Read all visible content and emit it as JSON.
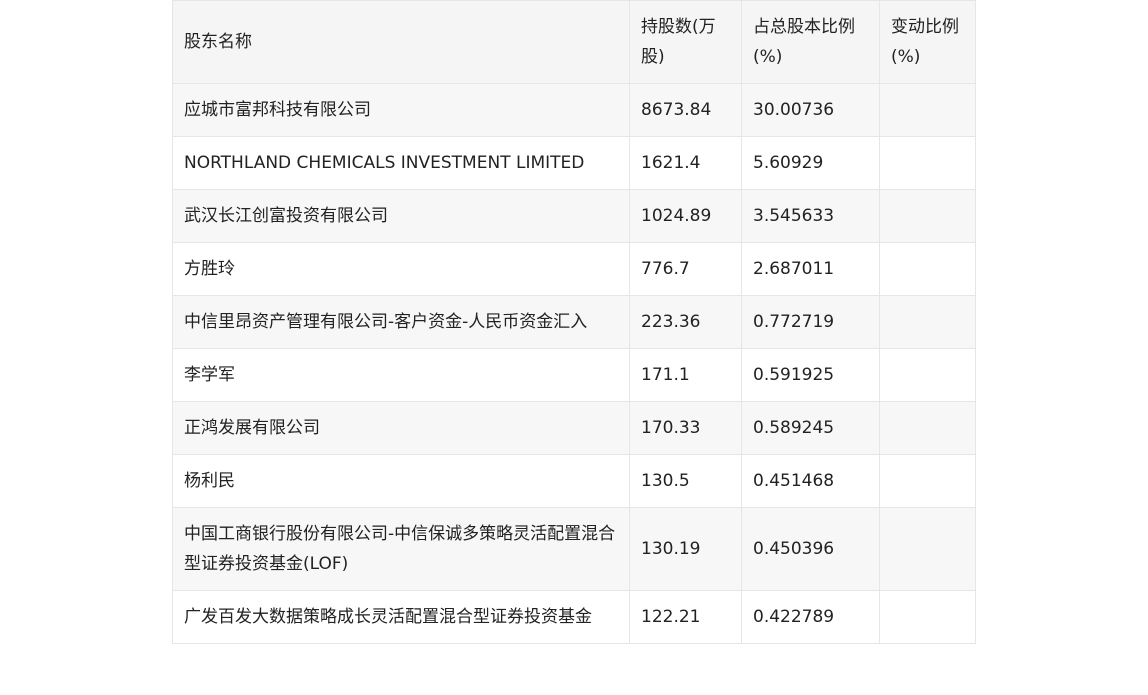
{
  "table": {
    "headers": {
      "name": "股东名称",
      "shares": "持股数(万股)",
      "ratio": "占总股本比例(%)",
      "change": "变动比例(%)"
    },
    "rows": [
      {
        "name": "应城市富邦科技有限公司",
        "shares": "8673.84",
        "ratio": "30.00736",
        "change": ""
      },
      {
        "name": "NORTHLAND CHEMICALS INVESTMENT LIMITED",
        "shares": "1621.4",
        "ratio": "5.60929",
        "change": ""
      },
      {
        "name": "武汉长江创富投资有限公司",
        "shares": "1024.89",
        "ratio": "3.545633",
        "change": ""
      },
      {
        "name": "方胜玲",
        "shares": "776.7",
        "ratio": "2.687011",
        "change": ""
      },
      {
        "name": "中信里昂资产管理有限公司-客户资金-人民币资金汇入",
        "shares": "223.36",
        "ratio": "0.772719",
        "change": ""
      },
      {
        "name": "李学军",
        "shares": "171.1",
        "ratio": "0.591925",
        "change": ""
      },
      {
        "name": "正鸿发展有限公司",
        "shares": "170.33",
        "ratio": "0.589245",
        "change": ""
      },
      {
        "name": "杨利民",
        "shares": "130.5",
        "ratio": "0.451468",
        "change": ""
      },
      {
        "name": "中国工商银行股份有限公司-中信保诚多策略灵活配置混合型证券投资基金(LOF)",
        "shares": "130.19",
        "ratio": "0.450396",
        "change": ""
      },
      {
        "name": "广发百发大数据策略成长灵活配置混合型证券投资基金",
        "shares": "122.21",
        "ratio": "0.422789",
        "change": ""
      }
    ]
  }
}
